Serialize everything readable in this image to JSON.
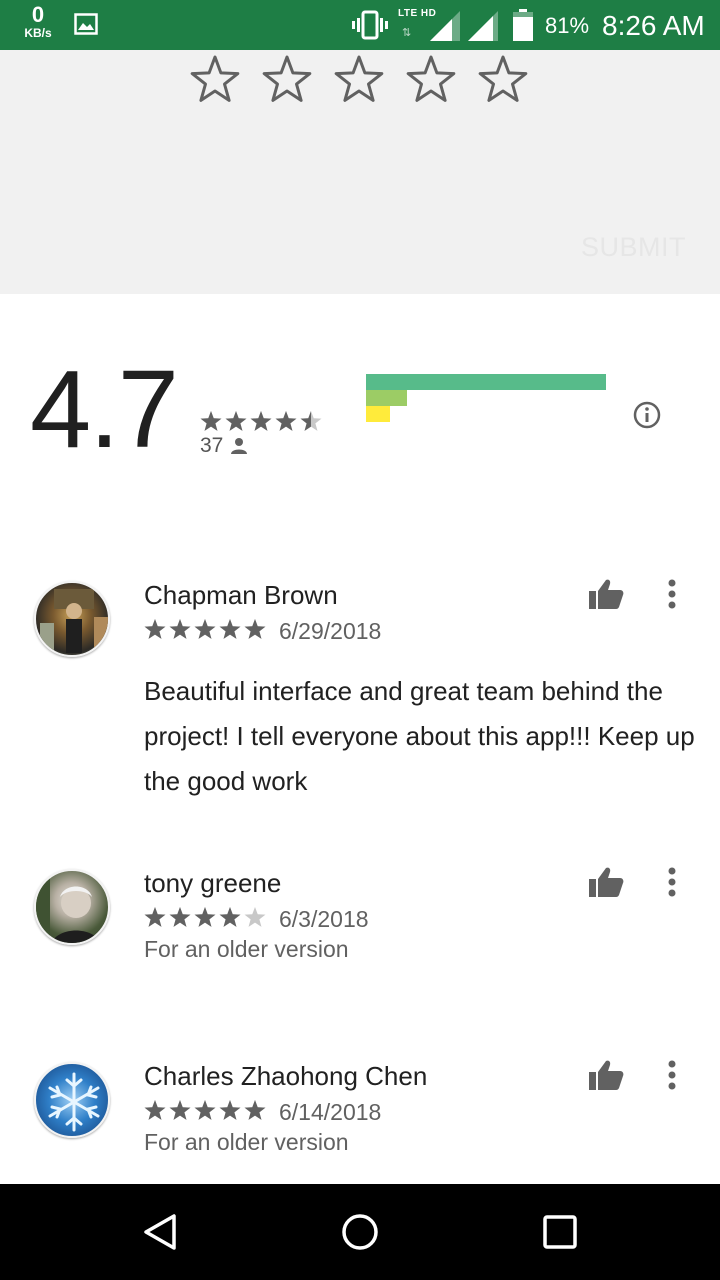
{
  "status_bar": {
    "speed_value": "0",
    "speed_unit": "KB/s",
    "network_label": "LTE HD",
    "network_arrows": "⇅",
    "battery_percent": "81%",
    "time": "8:26 AM"
  },
  "rate_prompt": {
    "star_count": 5,
    "submit_label": "SUBMIT"
  },
  "summary": {
    "average": "4.7",
    "average_stars": 4.5,
    "rating_count": "37",
    "distribution": [
      {
        "stars": 5,
        "fraction": 1.0,
        "color": "#57bb8a"
      },
      {
        "stars": 4,
        "fraction": 0.17,
        "color": "#9ccc65"
      },
      {
        "stars": 3,
        "fraction": 0.1,
        "color": "#ffeb3b"
      }
    ]
  },
  "reviews": [
    {
      "name": "Chapman Brown",
      "stars": 5,
      "date": "6/29/2018",
      "text": "Beautiful interface and great team behind the project! I tell everyone about this app!!! Keep up the good work",
      "note": ""
    },
    {
      "name": "tony greene",
      "stars": 4,
      "date": "6/3/2018",
      "text": "",
      "note": "For an older version"
    },
    {
      "name": "Charles Zhaohong Chen",
      "stars": 5,
      "date": "6/14/2018",
      "text": "",
      "note": "For an older version"
    }
  ],
  "colors": {
    "status_bar": "#1e7e45",
    "star_filled": "#616161",
    "star_empty": "#c8c8c8",
    "icon": "#616161"
  },
  "icons": {
    "status": [
      "gallery-icon",
      "vibrate-icon",
      "signal-icon",
      "battery-icon"
    ],
    "summary": [
      "person-icon",
      "info-icon"
    ],
    "review_actions": [
      "thumb-up-icon",
      "more-vert-icon"
    ],
    "navigation": [
      "back-icon",
      "home-icon",
      "recents-icon"
    ]
  }
}
